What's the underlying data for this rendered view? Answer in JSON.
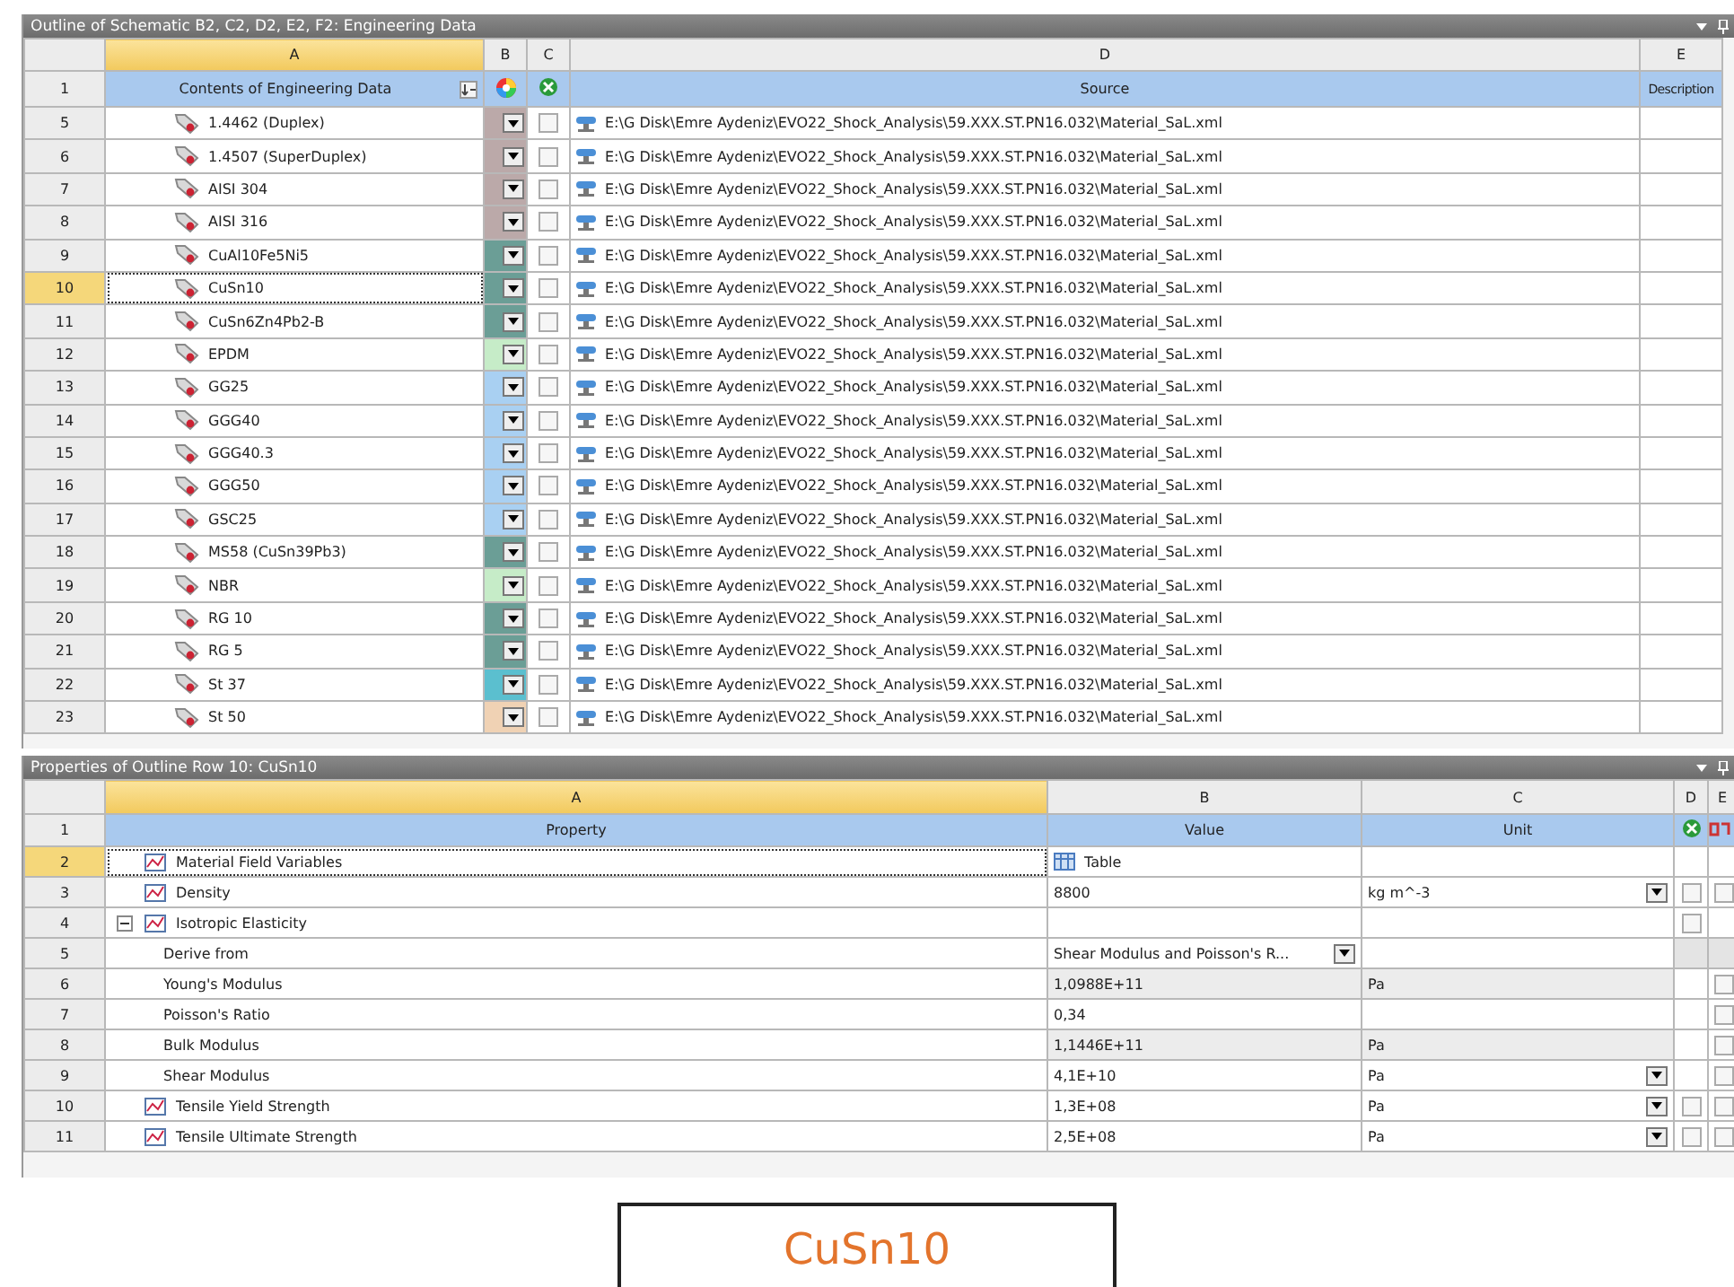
{
  "outline": {
    "title": "Outline of Schematic B2, C2, D2, E2, F2: Engineering Data",
    "column_letters": [
      "A",
      "B",
      "C",
      "D",
      "E"
    ],
    "header_row": {
      "number": "1",
      "contents": "Contents of Engineering Data",
      "source": "Source",
      "description": "Description"
    },
    "rows": [
      {
        "number": "5",
        "name": "1.4462 (Duplex)",
        "color": "#bba9a9",
        "checked": false,
        "selected": false,
        "source": "E:\\G Disk\\Emre Aydeniz\\EVO22_Shock_Analysis\\59.XXX.ST.PN16.032\\Material_SaL.xml"
      },
      {
        "number": "6",
        "name": "1.4507 (SuperDuplex)",
        "color": "#bba9a9",
        "checked": false,
        "selected": false,
        "source": "E:\\G Disk\\Emre Aydeniz\\EVO22_Shock_Analysis\\59.XXX.ST.PN16.032\\Material_SaL.xml"
      },
      {
        "number": "7",
        "name": "AISI 304",
        "color": "#bba9a9",
        "checked": false,
        "selected": false,
        "source": "E:\\G Disk\\Emre Aydeniz\\EVO22_Shock_Analysis\\59.XXX.ST.PN16.032\\Material_SaL.xml"
      },
      {
        "number": "8",
        "name": "AISI 316",
        "color": "#bba9a9",
        "checked": false,
        "selected": false,
        "source": "E:\\G Disk\\Emre Aydeniz\\EVO22_Shock_Analysis\\59.XXX.ST.PN16.032\\Material_SaL.xml"
      },
      {
        "number": "9",
        "name": "CuAl10Fe5Ni5",
        "color": "#6b9e96",
        "checked": false,
        "selected": false,
        "source": "E:\\G Disk\\Emre Aydeniz\\EVO22_Shock_Analysis\\59.XXX.ST.PN16.032\\Material_SaL.xml"
      },
      {
        "number": "10",
        "name": "CuSn10",
        "color": "#6b9e96",
        "checked": false,
        "selected": true,
        "source": "E:\\G Disk\\Emre Aydeniz\\EVO22_Shock_Analysis\\59.XXX.ST.PN16.032\\Material_SaL.xml"
      },
      {
        "number": "11",
        "name": "CuSn6Zn4Pb2-B",
        "color": "#6b9e96",
        "checked": false,
        "selected": false,
        "source": "E:\\G Disk\\Emre Aydeniz\\EVO22_Shock_Analysis\\59.XXX.ST.PN16.032\\Material_SaL.xml"
      },
      {
        "number": "12",
        "name": "EPDM",
        "color": "#c6ecc8",
        "checked": false,
        "selected": false,
        "source": "E:\\G Disk\\Emre Aydeniz\\EVO22_Shock_Analysis\\59.XXX.ST.PN16.032\\Material_SaL.xml"
      },
      {
        "number": "13",
        "name": "GG25",
        "color": "#a9d0f2",
        "checked": false,
        "selected": false,
        "source": "E:\\G Disk\\Emre Aydeniz\\EVO22_Shock_Analysis\\59.XXX.ST.PN16.032\\Material_SaL.xml"
      },
      {
        "number": "14",
        "name": "GGG40",
        "color": "#a9d0f2",
        "checked": false,
        "selected": false,
        "source": "E:\\G Disk\\Emre Aydeniz\\EVO22_Shock_Analysis\\59.XXX.ST.PN16.032\\Material_SaL.xml"
      },
      {
        "number": "15",
        "name": "GGG40.3",
        "color": "#a9d0f2",
        "checked": false,
        "selected": false,
        "source": "E:\\G Disk\\Emre Aydeniz\\EVO22_Shock_Analysis\\59.XXX.ST.PN16.032\\Material_SaL.xml"
      },
      {
        "number": "16",
        "name": "GGG50",
        "color": "#a9d0f2",
        "checked": false,
        "selected": false,
        "source": "E:\\G Disk\\Emre Aydeniz\\EVO22_Shock_Analysis\\59.XXX.ST.PN16.032\\Material_SaL.xml"
      },
      {
        "number": "17",
        "name": "GSC25",
        "color": "#a9d0f2",
        "checked": false,
        "selected": false,
        "source": "E:\\G Disk\\Emre Aydeniz\\EVO22_Shock_Analysis\\59.XXX.ST.PN16.032\\Material_SaL.xml"
      },
      {
        "number": "18",
        "name": "MS58 (CuSn39Pb3)",
        "color": "#6b9e96",
        "checked": false,
        "selected": false,
        "source": "E:\\G Disk\\Emre Aydeniz\\EVO22_Shock_Analysis\\59.XXX.ST.PN16.032\\Material_SaL.xml"
      },
      {
        "number": "19",
        "name": "NBR",
        "color": "#c6ecc8",
        "checked": false,
        "selected": false,
        "source": "E:\\G Disk\\Emre Aydeniz\\EVO22_Shock_Analysis\\59.XXX.ST.PN16.032\\Material_SaL.xml"
      },
      {
        "number": "20",
        "name": "RG 10",
        "color": "#6b9e96",
        "checked": false,
        "selected": false,
        "source": "E:\\G Disk\\Emre Aydeniz\\EVO22_Shock_Analysis\\59.XXX.ST.PN16.032\\Material_SaL.xml"
      },
      {
        "number": "21",
        "name": "RG 5",
        "color": "#6b9e96",
        "checked": false,
        "selected": false,
        "source": "E:\\G Disk\\Emre Aydeniz\\EVO22_Shock_Analysis\\59.XXX.ST.PN16.032\\Material_SaL.xml"
      },
      {
        "number": "22",
        "name": "St 37",
        "color": "#5bbfcf",
        "checked": false,
        "selected": false,
        "source": "E:\\G Disk\\Emre Aydeniz\\EVO22_Shock_Analysis\\59.XXX.ST.PN16.032\\Material_SaL.xml"
      },
      {
        "number": "23",
        "name": "St 50",
        "color": "#f0d2b4",
        "checked": false,
        "selected": false,
        "source": "E:\\G Disk\\Emre Aydeniz\\EVO22_Shock_Analysis\\59.XXX.ST.PN16.032\\Material_SaL.xml"
      }
    ]
  },
  "properties": {
    "title": "Properties of Outline Row 10: CuSn10",
    "column_letters": [
      "A",
      "B",
      "C",
      "D",
      "E"
    ],
    "header_row": {
      "number": "1",
      "property": "Property",
      "value": "Value",
      "unit": "Unit"
    },
    "rows": [
      {
        "number": "2",
        "property": "Material Field Variables",
        "selected": true,
        "value": "Table",
        "table_icon": true
      },
      {
        "number": "3",
        "property": "Density",
        "selected": false,
        "value": "8800",
        "unit": "kg m^-3",
        "unit_dropdown": true,
        "d_checkbox": {
          "checked": false
        },
        "e_checkbox": {
          "checked": false
        }
      },
      {
        "number": "4",
        "property": "Isotropic Elasticity",
        "selected": false,
        "expanded": true,
        "d_checkbox": {
          "checked": false
        },
        "children": [
          {
            "number": "5",
            "property": "Derive from",
            "selected": false,
            "value": "Shear Modulus and Poisson's R...",
            "value_dropdown": true,
            "greyed_checks": true
          },
          {
            "number": "6",
            "property": "Young's Modulus",
            "selected": false,
            "value": "1,0988E+11",
            "calculated": true,
            "unit": "Pa",
            "e_checkbox": {
              "checked": false
            }
          },
          {
            "number": "7",
            "property": "Poisson's Ratio",
            "selected": false,
            "value": "0,34",
            "e_checkbox": {
              "checked": false
            }
          },
          {
            "number": "8",
            "property": "Bulk Modulus",
            "selected": false,
            "value": "1,1446E+11",
            "calculated": true,
            "unit": "Pa",
            "e_checkbox": {
              "checked": false
            }
          },
          {
            "number": "9",
            "property": "Shear Modulus",
            "selected": false,
            "value": "4,1E+10",
            "unit": "Pa",
            "unit_dropdown": true,
            "e_checkbox": {
              "checked": false
            }
          }
        ]
      },
      {
        "number": "10",
        "property": "Tensile Yield Strength",
        "selected": false,
        "value": "1,3E+08",
        "unit": "Pa",
        "unit_dropdown": true,
        "d_checkbox": {
          "checked": false
        },
        "e_checkbox": {
          "checked": false
        }
      },
      {
        "number": "11",
        "property": "Tensile Ultimate Strength",
        "selected": false,
        "value": "2,5E+08",
        "unit": "Pa",
        "unit_dropdown": true,
        "d_checkbox": {
          "checked": false
        },
        "e_checkbox": {
          "checked": false
        }
      }
    ]
  },
  "caption": "CuSn10"
}
